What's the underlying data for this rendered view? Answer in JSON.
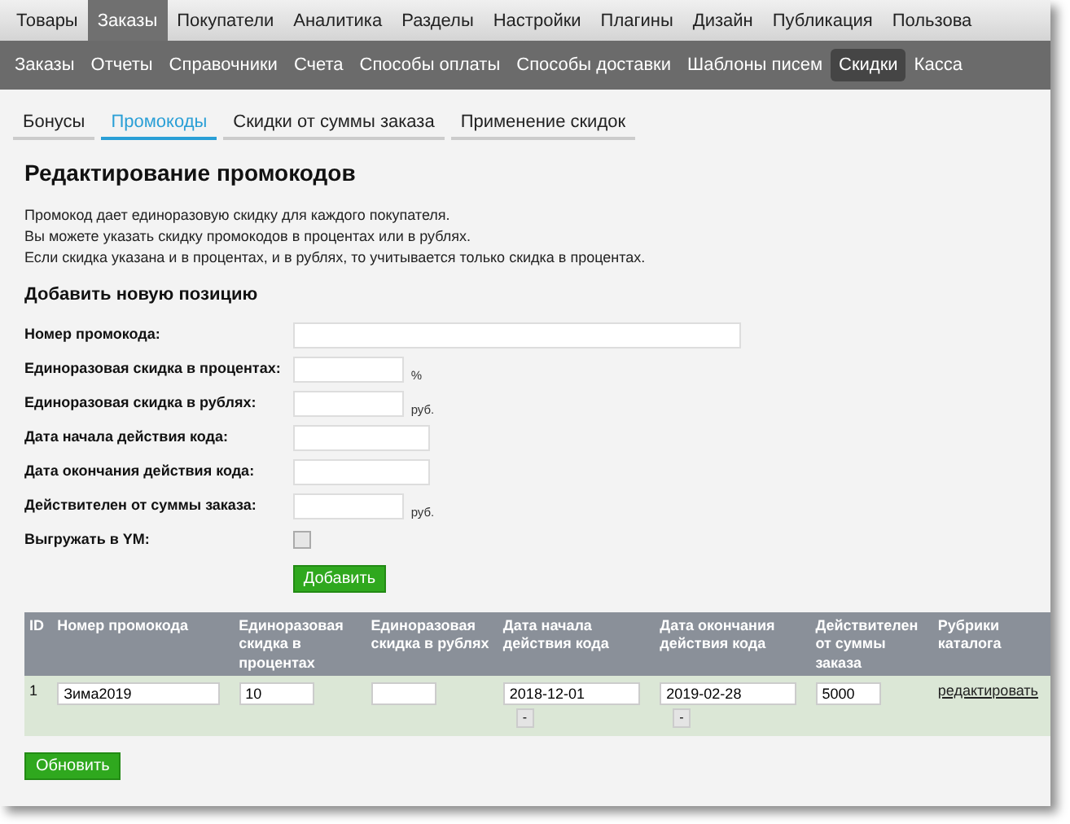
{
  "top_menu": [
    {
      "label": "Товары",
      "selected": false
    },
    {
      "label": "Заказы",
      "selected": true
    },
    {
      "label": "Покупатели",
      "selected": false
    },
    {
      "label": "Аналитика",
      "selected": false
    },
    {
      "label": "Разделы",
      "selected": false
    },
    {
      "label": "Настройки",
      "selected": false
    },
    {
      "label": "Плагины",
      "selected": false
    },
    {
      "label": "Дизайн",
      "selected": false
    },
    {
      "label": "Публикация",
      "selected": false
    },
    {
      "label": "Пользова",
      "selected": false
    }
  ],
  "sub_menu": [
    {
      "label": "Заказы",
      "selected": false
    },
    {
      "label": "Отчеты",
      "selected": false
    },
    {
      "label": "Справочники",
      "selected": false
    },
    {
      "label": "Счета",
      "selected": false
    },
    {
      "label": "Способы оплаты",
      "selected": false
    },
    {
      "label": "Способы доставки",
      "selected": false
    },
    {
      "label": "Шаблоны писем",
      "selected": false
    },
    {
      "label": "Скидки",
      "selected": true
    },
    {
      "label": "Касса",
      "selected": false
    }
  ],
  "tabs": [
    {
      "label": "Бонусы",
      "selected": false
    },
    {
      "label": "Промокоды",
      "selected": true
    },
    {
      "label": "Скидки от суммы заказа",
      "selected": false
    },
    {
      "label": "Применение скидок",
      "selected": false
    }
  ],
  "page_title": "Редактирование промокодов",
  "intro": [
    "Промокод дает единоразовую скидку для каждого покупателя.",
    "Вы можете указать скидку промокодов в процентах или в рублях.",
    "Если скидка указана и в процентах, и в рублях, то учитывается только скидка в процентах."
  ],
  "form": {
    "title": "Добавить новую позицию",
    "fields": [
      {
        "kind": "long",
        "label": "Номер промокода:"
      },
      {
        "kind": "short",
        "label": "Единоразовая скидка в процентах:",
        "unit": "%"
      },
      {
        "kind": "short",
        "label": "Единоразовая скидка в рублях:",
        "unit": "руб."
      },
      {
        "kind": "medium",
        "label": "Дата начала действия кода:"
      },
      {
        "kind": "medium",
        "label": "Дата окончания действия кода:"
      },
      {
        "kind": "short",
        "label": "Действителен от суммы заказа:",
        "unit": "руб."
      },
      {
        "kind": "checkbox",
        "label": "Выгружать в YM:",
        "checked": false
      }
    ],
    "submit": "Добавить"
  },
  "table": {
    "columns": [
      "ID",
      "Номер промокода",
      "Единоразовая скидка в процентах",
      "Единоразовая скидка в рублях",
      "Дата начала действия кода",
      "Дата окончания действия кода",
      "Действителен от суммы заказа",
      "Рубрики каталога"
    ],
    "rows": [
      {
        "cells": [
          {
            "kind": "text",
            "value": "1"
          },
          {
            "kind": "input",
            "value": "Зима2019"
          },
          {
            "kind": "input",
            "value": "10"
          },
          {
            "kind": "input"
          },
          {
            "kind": "date",
            "value": "2018-12-01",
            "button": "-"
          },
          {
            "kind": "date",
            "value": "2019-02-28",
            "button": "-"
          },
          {
            "kind": "input",
            "value": "5000"
          },
          {
            "kind": "link",
            "value": "редактировать"
          }
        ]
      }
    ]
  },
  "update_button": "Обновить"
}
